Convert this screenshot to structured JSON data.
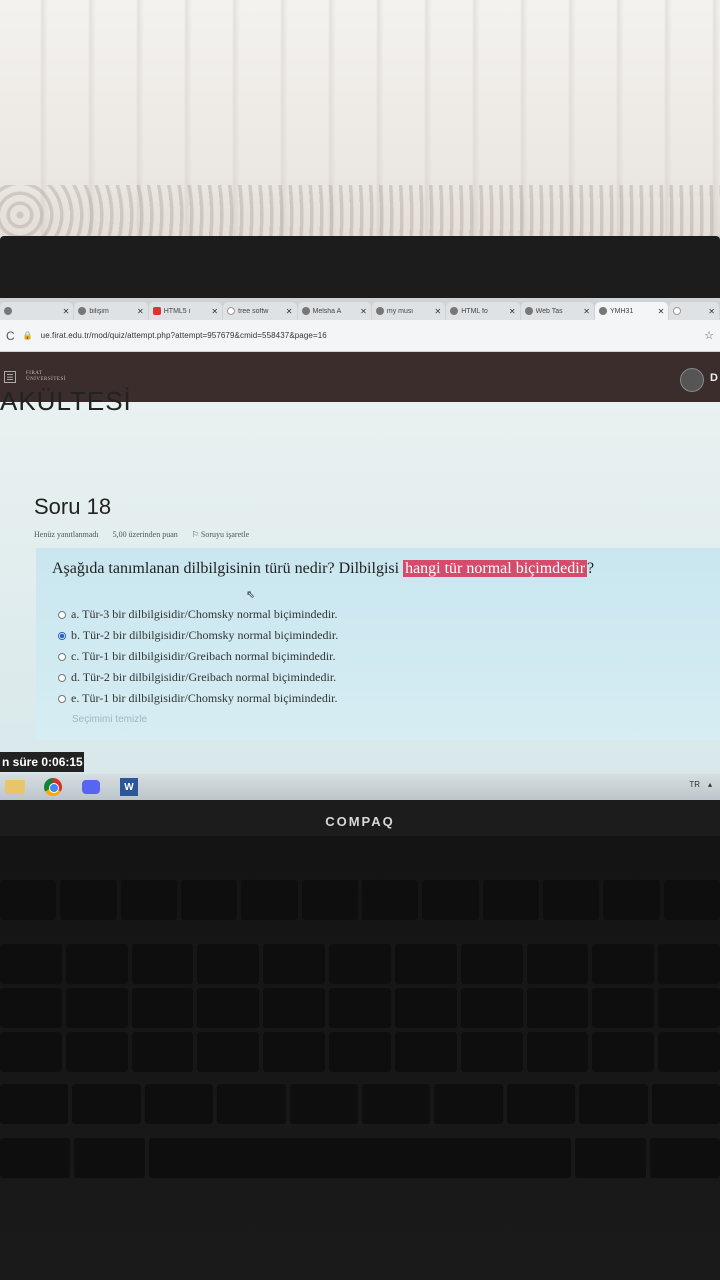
{
  "browser": {
    "tabs": [
      {
        "title": "",
        "icon": "page-icon"
      },
      {
        "title": "bilişim",
        "icon": "page-icon"
      },
      {
        "title": "HTML5 i",
        "icon": "youtube-icon"
      },
      {
        "title": "tree softw",
        "icon": "google-icon"
      },
      {
        "title": "Melsha A",
        "icon": "page-icon"
      },
      {
        "title": "my musi",
        "icon": "page-icon"
      },
      {
        "title": "HTML fo",
        "icon": "page-icon"
      },
      {
        "title": "Web Tas",
        "icon": "page-icon"
      },
      {
        "title": "YMH31",
        "icon": "page-icon",
        "active": true
      },
      {
        "title": "",
        "icon": "google-icon"
      }
    ],
    "url": "ue.firat.edu.tr/mod/quiz/attempt.php?attempt=957679&cmid=558437&page=16"
  },
  "header": {
    "logo_line1": "FIRAT",
    "logo_line2": "ÜNİVERSİTESİ",
    "user_initial": "D"
  },
  "page": {
    "faculty_partial": "AKÜLTESİ"
  },
  "question": {
    "title": "Soru 18",
    "status": "Henüz yanıtlanmadı",
    "points": "5,00 üzerinden puan",
    "flag": "Soruyu işaretle",
    "text_before": "Aşağıda tanımlanan dilbilgisinin türü nedir? Dilbilgisi ",
    "text_highlight": "hangi tür normal biçimdedir",
    "text_after": "?",
    "options": [
      {
        "label": "a. Tür-3 bir dilbilgisidir/Chomsky normal biçimindedir.",
        "checked": false
      },
      {
        "label": "b. Tür-2 bir dilbilgisidir/Chomsky normal biçimindedir.",
        "checked": true
      },
      {
        "label": "c. Tür-1 bir dilbilgisidir/Greibach normal biçimindedir.",
        "checked": false
      },
      {
        "label": "d. Tür-2 bir dilbilgisidir/Greibach normal biçimindedir.",
        "checked": false
      },
      {
        "label": "e. Tür-1 bir dilbilgisidir/Chomsky normal biçimindedir.",
        "checked": false
      }
    ],
    "clear_choice": "Seçimimi temizle"
  },
  "timer": {
    "label": "n süre 0:06:15"
  },
  "taskbar": {
    "tray_text": "TR"
  },
  "laptop": {
    "brand": "COMPAQ"
  }
}
